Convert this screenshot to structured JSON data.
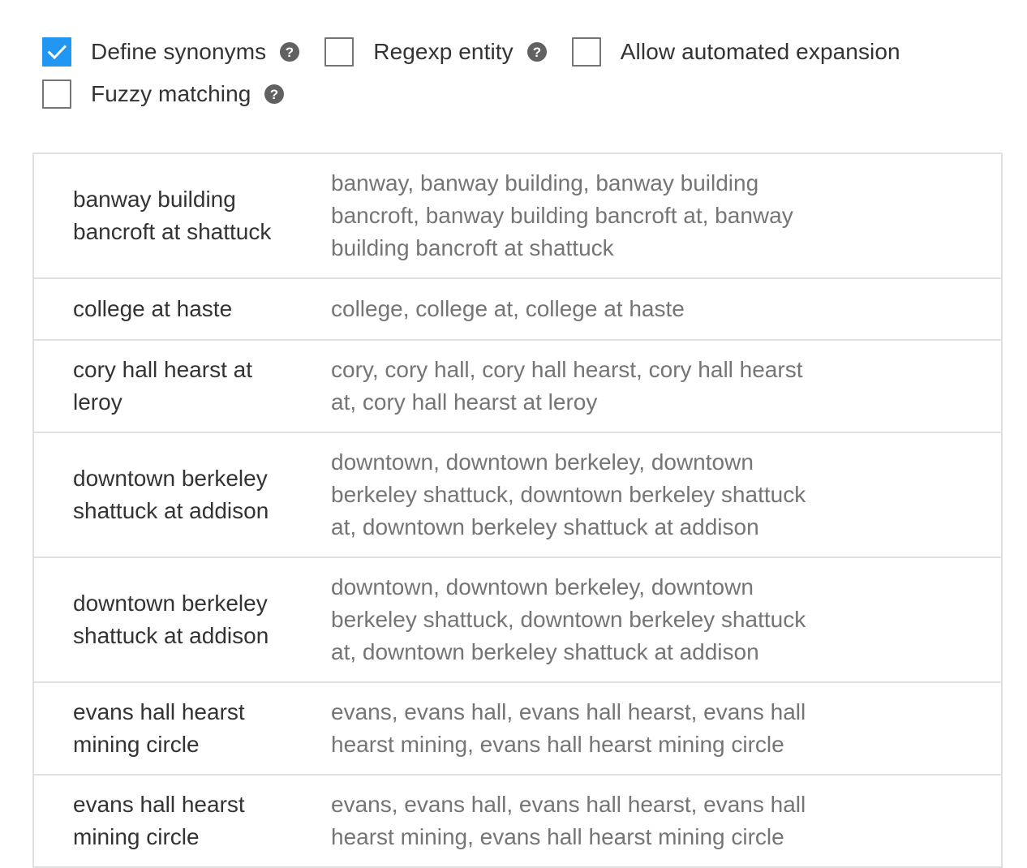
{
  "options": {
    "define_synonyms": {
      "label": "Define synonyms",
      "checked": true
    },
    "regexp_entity": {
      "label": "Regexp entity",
      "checked": false
    },
    "allow_automated_expansion": {
      "label": "Allow automated expansion",
      "checked": false
    },
    "fuzzy_matching": {
      "label": "Fuzzy matching",
      "checked": false
    }
  },
  "colors": {
    "accent": "#2196f3",
    "border": "#e0e0e0",
    "text": "#333333",
    "muted": "#757575"
  },
  "entries": [
    {
      "value": "banway building bancroft at shattuck",
      "synonyms": "banway, banway building, banway building bancroft, banway building bancroft at, banway building bancroft at shattuck"
    },
    {
      "value": "college at haste",
      "synonyms": "college, college at, college at haste"
    },
    {
      "value": "cory hall hearst at leroy",
      "synonyms": "cory, cory hall, cory hall hearst, cory hall hearst at, cory hall hearst at leroy"
    },
    {
      "value": "downtown berkeley shattuck at addison",
      "synonyms": "downtown, downtown berkeley, downtown berkeley shattuck, downtown berkeley shattuck at, downtown berkeley shattuck at addison"
    },
    {
      "value": "downtown berkeley shattuck at addison",
      "synonyms": "downtown, downtown berkeley, downtown berkeley shattuck, downtown berkeley shattuck at, downtown berkeley shattuck at addison"
    },
    {
      "value": "evans hall hearst mining circle",
      "synonyms": "evans, evans hall, evans hall hearst, evans hall hearst mining, evans hall hearst mining circle"
    },
    {
      "value": "evans hall hearst mining circle",
      "synonyms": "evans, evans hall, evans hall hearst, evans hall hearst mining, evans hall hearst mining circle"
    }
  ]
}
